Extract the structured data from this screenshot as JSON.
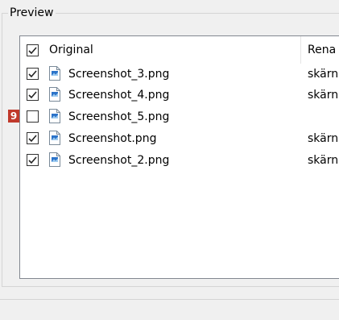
{
  "group": {
    "title": "Preview"
  },
  "list": {
    "columns": [
      {
        "label": "Original"
      },
      {
        "label": "Rena"
      }
    ],
    "header_checked": true,
    "rows": [
      {
        "name": "Screenshot_3.png",
        "renamed": "skärn",
        "checked": true
      },
      {
        "name": "Screenshot_4.png",
        "renamed": "skärn",
        "checked": true
      },
      {
        "name": "Screenshot_5.png",
        "renamed": "",
        "checked": false
      },
      {
        "name": "Screenshot.png",
        "renamed": "skärn",
        "checked": true
      },
      {
        "name": "Screenshot_2.png",
        "renamed": "skärn",
        "checked": true
      }
    ]
  },
  "badge": {
    "label": "9",
    "color": "#c0392b"
  },
  "icons": {
    "file": "image-file-icon",
    "check": "checkmark-icon"
  }
}
